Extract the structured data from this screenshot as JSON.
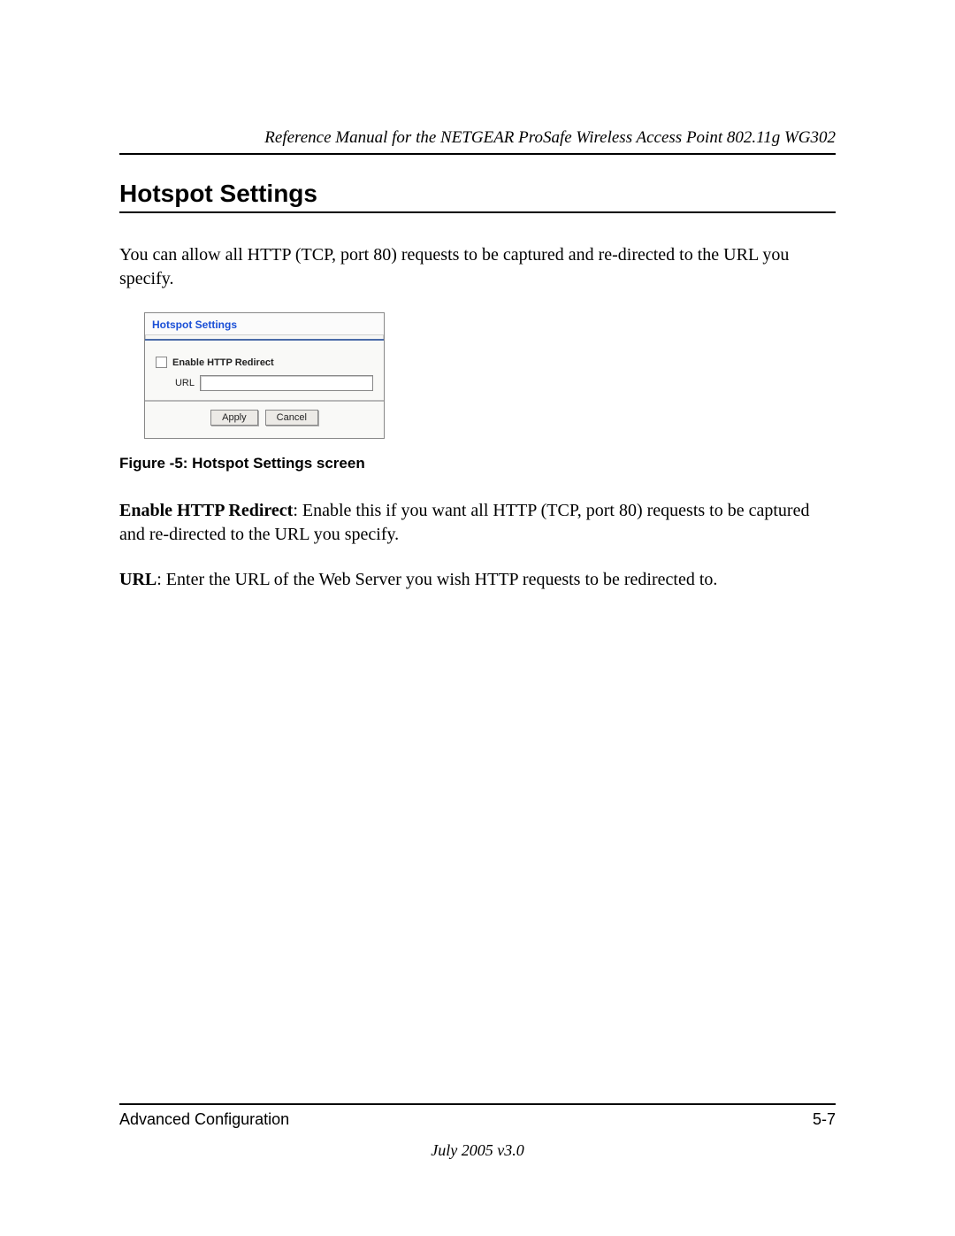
{
  "header": {
    "doc_title": "Reference Manual for the NETGEAR ProSafe Wireless Access Point 802.11g WG302"
  },
  "section": {
    "title": "Hotspot Settings",
    "intro": "You can allow all HTTP (TCP, port 80) requests to be captured and re-directed to the URL you specify."
  },
  "screenshot": {
    "panel_title": "Hotspot Settings",
    "checkbox_label": "Enable HTTP Redirect",
    "url_label": "URL",
    "url_value": "",
    "apply_label": "Apply",
    "cancel_label": "Cancel"
  },
  "figure_caption": "Figure -5:  Hotspot Settings screen",
  "definitions": {
    "d1_term": "Enable HTTP Redirect",
    "d1_text": ": Enable this if you want all HTTP (TCP, port 80) requests to be captured and re-directed to the URL you specify.",
    "d2_term": "URL",
    "d2_text": ": Enter the URL of the Web Server you wish HTTP requests to be redirected to."
  },
  "footer": {
    "chapter": "Advanced Configuration",
    "page": "5-7",
    "version": "July 2005 v3.0"
  }
}
